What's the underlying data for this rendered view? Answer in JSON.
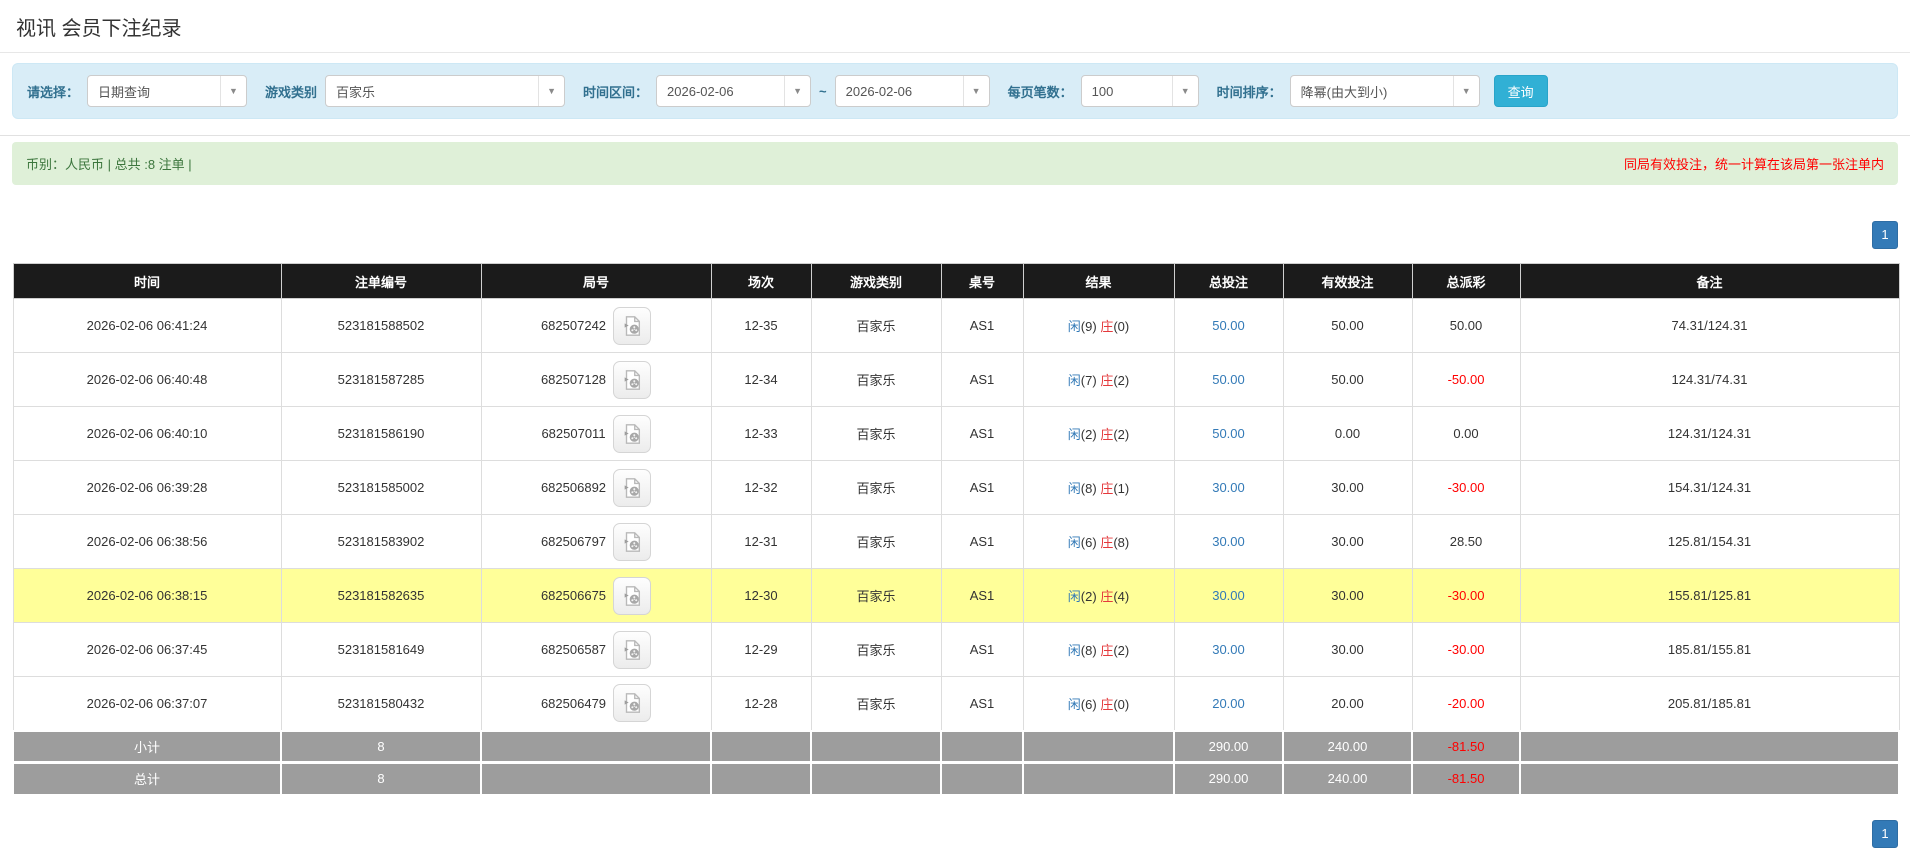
{
  "page": {
    "title": "视讯 会员下注纪录"
  },
  "filters": {
    "select_label": "请选择：",
    "select_value": "日期查询",
    "game_label": "游戏类别",
    "game_value": "百家乐",
    "range_label": "时间区间：",
    "range_from": "2026-02-06",
    "range_tilde": "~",
    "range_to": "2026-02-06",
    "per_page_label": "每页笔数：",
    "per_page_value": "100",
    "sort_label": "时间排序：",
    "sort_value": "降幂(由大到小)",
    "search_button": "查询"
  },
  "summary": {
    "left": "币别：人民币 | 总共 :8 注单 |",
    "right": "同局有效投注，统一计算在该局第一张注单内"
  },
  "pagination": {
    "page": "1"
  },
  "table": {
    "headers": [
      "时间",
      "注单编号",
      "局号",
      "场次",
      "游戏类别",
      "桌号",
      "结果",
      "总投注",
      "有效投注",
      "总派彩",
      "备注"
    ],
    "rows": [
      {
        "time": "2026-02-06 06:41:24",
        "bet_id": "523181588502",
        "round_id": "682507242",
        "session": "12-35",
        "game": "百家乐",
        "table_no": "AS1",
        "result": {
          "player_label": "闲",
          "player_num": "(9)",
          "banker_label": "庄",
          "banker_num": "(0)"
        },
        "total_bet": "50.00",
        "valid_bet": "50.00",
        "payout": "50.00",
        "note": "74.31/124.31",
        "highlight": false
      },
      {
        "time": "2026-02-06 06:40:48",
        "bet_id": "523181587285",
        "round_id": "682507128",
        "session": "12-34",
        "game": "百家乐",
        "table_no": "AS1",
        "result": {
          "player_label": "闲",
          "player_num": "(7)",
          "banker_label": "庄",
          "banker_num": "(2)"
        },
        "total_bet": "50.00",
        "valid_bet": "50.00",
        "payout": "-50.00",
        "note": "124.31/74.31",
        "highlight": false
      },
      {
        "time": "2026-02-06 06:40:10",
        "bet_id": "523181586190",
        "round_id": "682507011",
        "session": "12-33",
        "game": "百家乐",
        "table_no": "AS1",
        "result": {
          "player_label": "闲",
          "player_num": "(2)",
          "banker_label": "庄",
          "banker_num": "(2)"
        },
        "total_bet": "50.00",
        "valid_bet": "0.00",
        "payout": "0.00",
        "note": "124.31/124.31",
        "highlight": false
      },
      {
        "time": "2026-02-06 06:39:28",
        "bet_id": "523181585002",
        "round_id": "682506892",
        "session": "12-32",
        "game": "百家乐",
        "table_no": "AS1",
        "result": {
          "player_label": "闲",
          "player_num": "(8)",
          "banker_label": "庄",
          "banker_num": "(1)"
        },
        "total_bet": "30.00",
        "valid_bet": "30.00",
        "payout": "-30.00",
        "note": "154.31/124.31",
        "highlight": false
      },
      {
        "time": "2026-02-06 06:38:56",
        "bet_id": "523181583902",
        "round_id": "682506797",
        "session": "12-31",
        "game": "百家乐",
        "table_no": "AS1",
        "result": {
          "player_label": "闲",
          "player_num": "(6)",
          "banker_label": "庄",
          "banker_num": "(8)"
        },
        "total_bet": "30.00",
        "valid_bet": "30.00",
        "payout": "28.50",
        "note": "125.81/154.31",
        "highlight": false
      },
      {
        "time": "2026-02-06 06:38:15",
        "bet_id": "523181582635",
        "round_id": "682506675",
        "session": "12-30",
        "game": "百家乐",
        "table_no": "AS1",
        "result": {
          "player_label": "闲",
          "player_num": "(2)",
          "banker_label": "庄",
          "banker_num": "(4)"
        },
        "total_bet": "30.00",
        "valid_bet": "30.00",
        "payout": "-30.00",
        "note": "155.81/125.81",
        "highlight": true
      },
      {
        "time": "2026-02-06 06:37:45",
        "bet_id": "523181581649",
        "round_id": "682506587",
        "session": "12-29",
        "game": "百家乐",
        "table_no": "AS1",
        "result": {
          "player_label": "闲",
          "player_num": "(8)",
          "banker_label": "庄",
          "banker_num": "(2)"
        },
        "total_bet": "30.00",
        "valid_bet": "30.00",
        "payout": "-30.00",
        "note": "185.81/155.81",
        "highlight": false
      },
      {
        "time": "2026-02-06 06:37:07",
        "bet_id": "523181580432",
        "round_id": "682506479",
        "session": "12-28",
        "game": "百家乐",
        "table_no": "AS1",
        "result": {
          "player_label": "闲",
          "player_num": "(6)",
          "banker_label": "庄",
          "banker_num": "(0)"
        },
        "total_bet": "20.00",
        "valid_bet": "20.00",
        "payout": "-20.00",
        "note": "205.81/185.81",
        "highlight": false
      }
    ],
    "subtotal": {
      "label": "小计",
      "count": "8",
      "total_bet": "290.00",
      "valid_bet": "240.00",
      "payout": "-81.50"
    },
    "total": {
      "label": "总计",
      "count": "8",
      "total_bet": "290.00",
      "valid_bet": "240.00",
      "payout": "-81.50"
    }
  },
  "colors": {
    "accent_blue": "#31b0d5",
    "link_blue": "#337ab7",
    "pager_blue": "#337ab7",
    "red": "#ff0000",
    "result_red": "#e4393c",
    "green_bg": "#dff0d8",
    "green_text": "#3c763d",
    "panel_blue": "#d9edf7",
    "label_blue": "#31708f",
    "header_bg": "#1b1b1b",
    "footer_grey": "#9d9d9d",
    "row_highlight": "#ffff99"
  }
}
